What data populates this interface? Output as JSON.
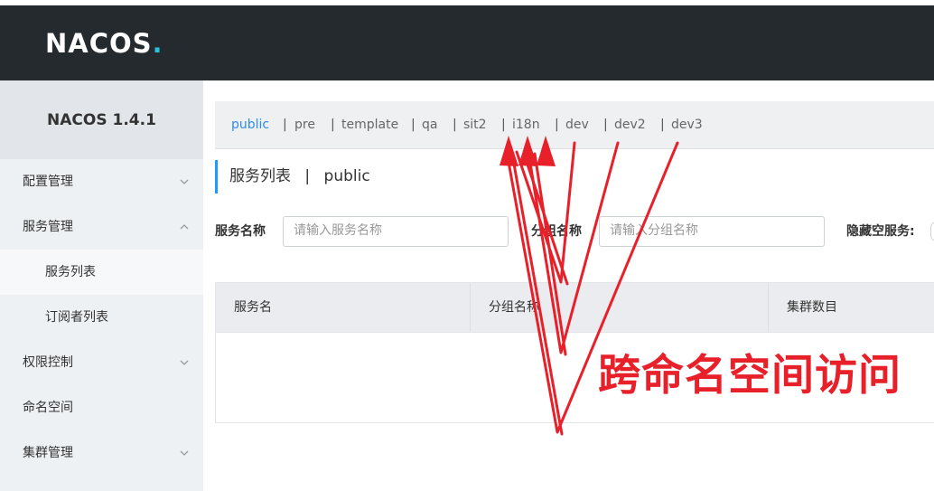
{
  "header": {
    "logo_text": "NACOS"
  },
  "sidebar": {
    "version": "NACOS 1.4.1",
    "items": [
      {
        "label": "配置管理",
        "chevron": "down"
      },
      {
        "label": "服务管理",
        "chevron": "up"
      },
      {
        "label": "服务列表",
        "sub": true,
        "active": true
      },
      {
        "label": "订阅者列表",
        "sub": true
      },
      {
        "label": "权限控制",
        "chevron": "down"
      },
      {
        "label": "命名空间"
      },
      {
        "label": "集群管理",
        "chevron": "down"
      }
    ]
  },
  "namespaces": {
    "items": [
      "public",
      "pre",
      "template",
      "qa",
      "sit2",
      "i18n",
      "dev",
      "dev2",
      "dev3"
    ],
    "selected": "public",
    "separator": "|"
  },
  "page": {
    "title": "服务列表",
    "title_sep": "|",
    "namespace": "public"
  },
  "filters": {
    "service_name_label": "服务名称",
    "service_name_placeholder": "请输入服务名称",
    "group_name_label": "分组名称",
    "group_name_placeholder": "请输入分组名称",
    "hide_empty_label": "隐藏空服务:"
  },
  "table": {
    "columns": [
      "服务名",
      "分组名称",
      "集群数目"
    ]
  },
  "annotation": {
    "text": "跨命名空间访问",
    "color": "#e8202a"
  },
  "colors": {
    "header_bg": "#252a2f",
    "accent": "#2d8cf0",
    "sidebar_bg": "#eef1f4"
  }
}
